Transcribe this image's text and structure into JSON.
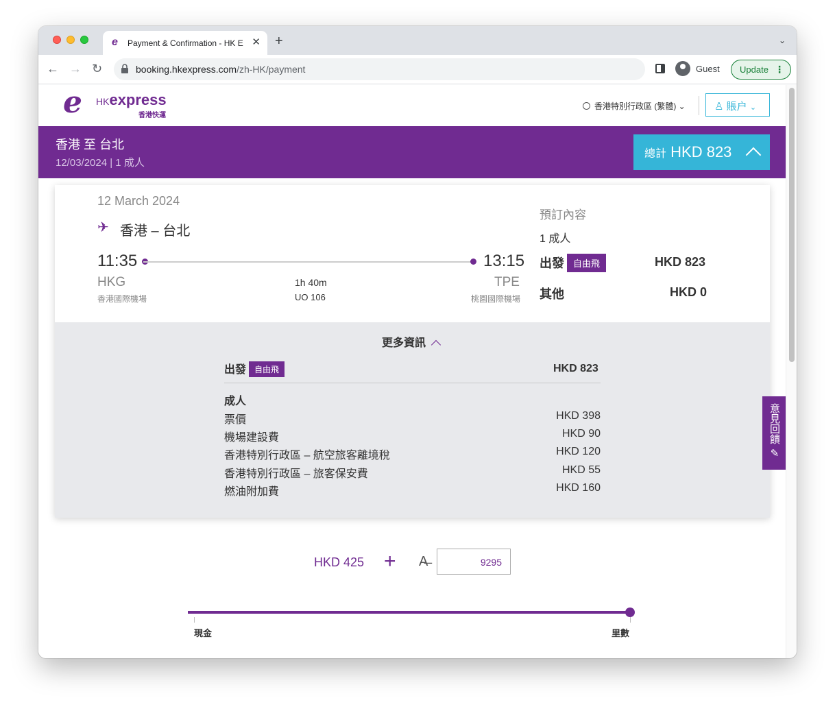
{
  "browser": {
    "tab_title": "Payment & Confirmation - HK E",
    "tab_favicon": "e",
    "url_host": "booking.hkexpress.com",
    "url_path": "/zh-HK/payment",
    "profile_label": "Guest",
    "update_label": "Update"
  },
  "header": {
    "logo_hk": "HK",
    "logo_express": "express",
    "logo_cn": "香港快運",
    "language": "香港特別行政區 (繁體)",
    "account_label": "賬户"
  },
  "banner": {
    "route": "香港 至 台北",
    "subtitle": "12/03/2024 | 1 成人",
    "total_prefix": "總計",
    "total_amount": "HKD 823"
  },
  "flight": {
    "date": "12 March 2024",
    "route": "香港 – 台北",
    "departure_time": "11:35",
    "arrival_time": "13:15",
    "departure_code": "HKG",
    "arrival_code": "TPE",
    "departure_airport": "香港國際機場",
    "arrival_airport": "桃園國際機場",
    "duration": "1h 40m",
    "flight_number": "UO 106"
  },
  "summary": {
    "title": "預訂內容",
    "passengers": "1 成人",
    "departure_label": "出發",
    "fare_badge": "自由飛",
    "departure_amount": "HKD 823",
    "other_label": "其他",
    "other_amount": "HKD 0"
  },
  "more_info": {
    "toggle_label": "更多資訊",
    "departure_label": "出發",
    "fare_badge": "自由飛",
    "departure_amount": "HKD 823",
    "group_label": "成人",
    "fees": [
      {
        "label": "票價",
        "amount": "HKD 398"
      },
      {
        "label": "機場建設費",
        "amount": "HKD 90"
      },
      {
        "label": "香港特別行政區 – 航空旅客離境稅",
        "amount": "HKD 120"
      },
      {
        "label": "香港特別行政區 – 旅客保安費",
        "amount": "HKD 55"
      },
      {
        "label": "燃油附加費",
        "amount": "HKD 160"
      }
    ]
  },
  "payment": {
    "cash_amount": "HKD 425",
    "plus": "+",
    "miles_symbol": "A̶",
    "miles_value": "9295",
    "slider_left_label": "現金",
    "slider_right_label": "里數",
    "slider_level": 1.0
  },
  "feedback": {
    "label": "意見回饋"
  },
  "colors": {
    "brand_purple": "#702b91",
    "accent_cyan": "#35b5d8",
    "update_green": "#188038"
  }
}
